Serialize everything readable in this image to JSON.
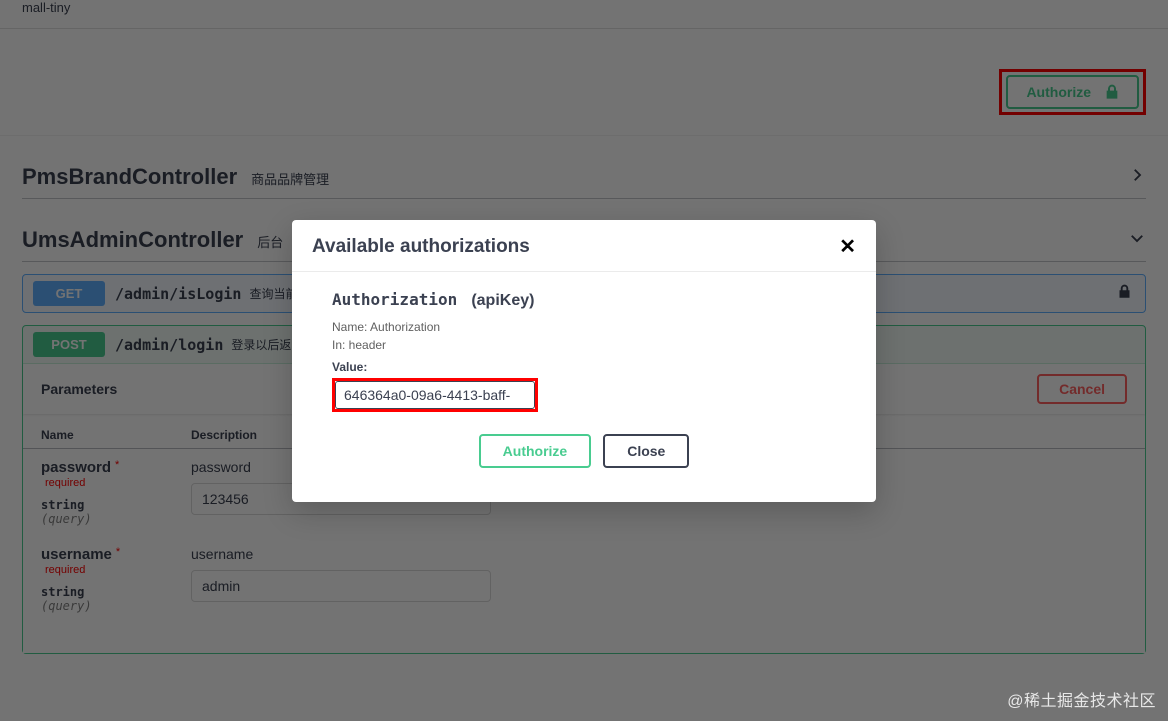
{
  "page_title": "mall-tiny",
  "header": {
    "authorize_label": "Authorize"
  },
  "controllers": [
    {
      "name": "PmsBrandController",
      "desc": "商品品牌管理",
      "expanded": false
    },
    {
      "name": "UmsAdminController",
      "desc": "后台",
      "expanded": true
    }
  ],
  "operations": {
    "get": {
      "method": "GET",
      "path": "/admin/isLogin",
      "summary": "查询当前登录"
    },
    "post": {
      "method": "POST",
      "path": "/admin/login",
      "summary": "登录以后返回to"
    }
  },
  "params_section": {
    "title": "Parameters",
    "cancel": "Cancel",
    "columns": {
      "name": "Name",
      "description": "Description"
    },
    "required_label": "* required",
    "rows": [
      {
        "name": "password",
        "type": "string",
        "in": "(query)",
        "desc": "password",
        "value": "123456"
      },
      {
        "name": "username",
        "type": "string",
        "in": "(query)",
        "desc": "username",
        "value": "admin"
      }
    ]
  },
  "modal": {
    "title": "Available authorizations",
    "auth_name": "Authorization",
    "scheme": "(apiKey)",
    "name_line": "Name: Authorization",
    "in_line": "In: header",
    "value_label": "Value:",
    "value_input": "646364a0-09a6-4413-baff-",
    "authorize_btn": "Authorize",
    "close_btn": "Close"
  },
  "watermark": "@稀土掘金技术社区"
}
